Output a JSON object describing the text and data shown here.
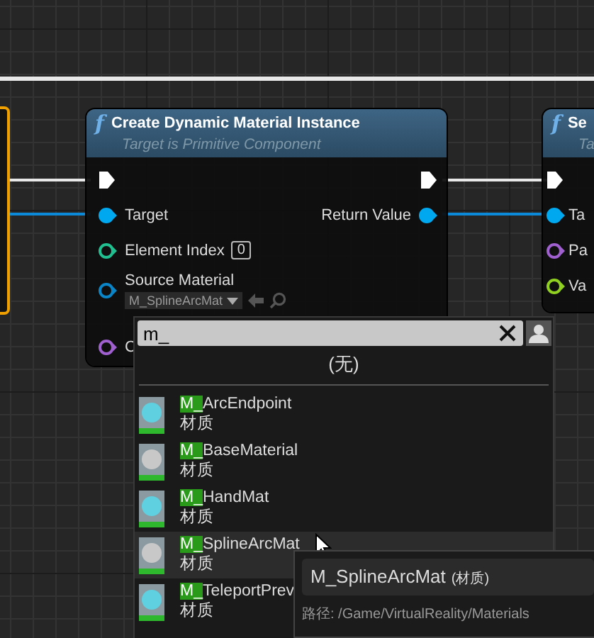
{
  "nodes": [
    {
      "icon": "f",
      "title": "Create Dynamic Material Instance",
      "subtitle": "Target is Primitive Component",
      "exec_in": true,
      "exec_out": true,
      "inputs": [
        {
          "kind": "data",
          "label": "Target",
          "color": "#00a8f0",
          "connected": true
        },
        {
          "kind": "value",
          "label": "Element Index",
          "color": "#20c090",
          "connected": false,
          "value": "0"
        },
        {
          "kind": "asset",
          "label": "Source Material",
          "color": "#0a86c8",
          "connected": false,
          "value": "M_SplineArcMat"
        },
        {
          "kind": "data",
          "label": "C",
          "color": "#a060d0",
          "connected": false
        }
      ],
      "outputs": [
        {
          "kind": "data",
          "label": "Return Value",
          "color": "#00a8f0",
          "connected": true
        }
      ]
    },
    {
      "icon": "f",
      "title": "Se",
      "subtitle": "Ta",
      "exec_in": true,
      "exec_out": false,
      "inputs": [
        {
          "kind": "data",
          "label": "Ta",
          "color": "#00a8f0",
          "connected": true
        },
        {
          "kind": "data",
          "label": "Pa",
          "color": "#a060d0",
          "connected": false
        },
        {
          "kind": "data",
          "label": "Va",
          "color": "#90d020",
          "connected": false
        }
      ]
    }
  ],
  "picker": {
    "search": {
      "value": "m_"
    },
    "none_option": "(无)",
    "items": [
      {
        "match": "M_",
        "rest": "ArcEndpoint",
        "type": "材质",
        "hovered": false
      },
      {
        "match": "M_",
        "rest": "BaseMaterial",
        "type": "材质",
        "hovered": false
      },
      {
        "match": "M_",
        "rest": "HandMat",
        "type": "材质",
        "hovered": false
      },
      {
        "match": "M_",
        "rest": "SplineArcMat",
        "type": "材质",
        "hovered": true
      },
      {
        "match": "M_",
        "rest": "TeleportPrev",
        "type": "材质",
        "hovered": false
      }
    ]
  },
  "tooltip": {
    "title": "M_SplineArcMat",
    "type": "(材质)",
    "path": "路径: /Game/VirtualReality/Materials"
  }
}
